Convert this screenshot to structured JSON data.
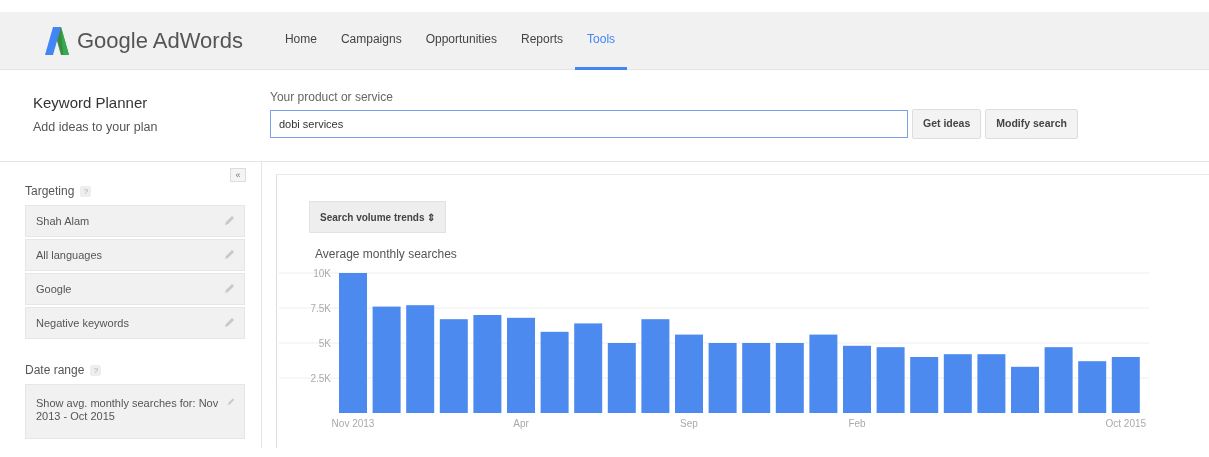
{
  "brand": {
    "name": "Google AdWords"
  },
  "nav": [
    {
      "label": "Home",
      "selected": false
    },
    {
      "label": "Campaigns",
      "selected": false
    },
    {
      "label": "Opportunities",
      "selected": false
    },
    {
      "label": "Reports",
      "selected": false
    },
    {
      "label": "Tools",
      "selected": true
    }
  ],
  "page": {
    "title": "Keyword Planner",
    "subtitle": "Add ideas to your plan"
  },
  "search": {
    "label": "Your product or service",
    "value": "dobi services",
    "buttons": [
      "Get ideas",
      "Modify search"
    ]
  },
  "sidebar": {
    "collapse": "«",
    "sections": [
      {
        "title": "Targeting",
        "help": "?",
        "items": [
          "Shah Alam",
          "All languages",
          "Google",
          "Negative keywords"
        ]
      },
      {
        "title": "Date range",
        "help": "?",
        "items": [
          "Show avg. monthly searches for: Nov 2013 - Oct 2015"
        ]
      }
    ]
  },
  "chart_panel": {
    "selector": "Search volume trends ⇕",
    "chart_data": {
      "type": "bar",
      "title": "Average monthly searches",
      "categories": [
        "Nov 2013",
        null,
        null,
        null,
        null,
        "Apr",
        null,
        null,
        null,
        null,
        "Sep",
        null,
        null,
        null,
        null,
        "Feb",
        null,
        null,
        null,
        null,
        null,
        null,
        null,
        "Oct 2015"
      ],
      "values": [
        10000,
        7600,
        7700,
        6700,
        7000,
        6800,
        5800,
        6400,
        5000,
        6700,
        5600,
        5000,
        5000,
        5000,
        5600,
        4800,
        4700,
        4000,
        4200,
        4200,
        3300,
        4700,
        3700,
        4000
      ],
      "ylim": [
        0,
        10000
      ],
      "grid": true,
      "yticks": [
        {
          "value": 2500,
          "label": "2.5K"
        },
        {
          "value": 5000,
          "label": "5K"
        },
        {
          "value": 7500,
          "label": "7.5K"
        },
        {
          "value": 10000,
          "label": "10K"
        }
      ]
    }
  }
}
